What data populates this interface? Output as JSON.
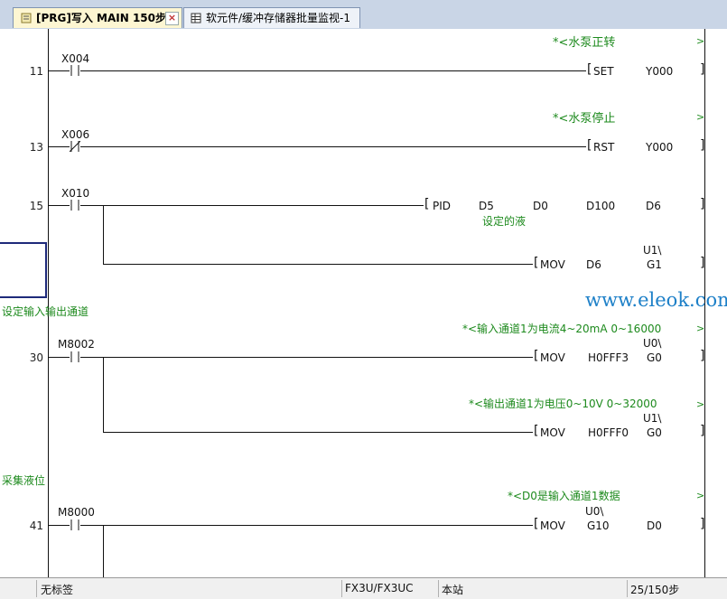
{
  "tabs": [
    {
      "label": "[PRG]写入 MAIN 150步",
      "close": "×"
    },
    {
      "label": "软元件/缓冲存储器批量监视-1"
    }
  ],
  "rungs": [
    {
      "step": "11",
      "contact": "X004",
      "comment": "*<水泵正转",
      "instr": "SET",
      "op1": "Y000"
    },
    {
      "step": "13",
      "contact": "X006",
      "comment": "*<水泵停止",
      "instr": "RST",
      "op1": "Y000"
    },
    {
      "step": "15",
      "contact": "X010",
      "instr": "PID",
      "ops": [
        "D5",
        "D0",
        "D100",
        "D6"
      ],
      "op_comment": "设定的液",
      "branch": {
        "instr": "MOV",
        "op1": "D6",
        "op2_top": "U1\\",
        "op2_bot": "G1"
      }
    },
    {
      "statement": "设定输入输出通道",
      "step": "30",
      "contact": "M8002",
      "comment": "*<输入通道1为电流4~20mA  0~16000",
      "instr": "MOV",
      "op1": "H0FFF3",
      "op2_top": "U0\\",
      "op2_bot": "G0",
      "branch": {
        "comment": "*<输出通道1为电压0~10V 0~32000",
        "instr": "MOV",
        "op1": "H0FFF0",
        "op2_top": "U1\\",
        "op2_bot": "G0"
      }
    },
    {
      "statement": "采集液位",
      "step": "41",
      "contact": "M8000",
      "comment": "*<D0是输入通道1数据",
      "instr": "MOV",
      "op1_top": "U0\\",
      "op1_bot": "G10",
      "op2": "D0"
    }
  ],
  "watermark": "www.eleok.com",
  "status": {
    "label": "无标签",
    "cpu": "FX3U/FX3UC",
    "station": "本站",
    "steps": "25/150步"
  },
  "colors": {
    "comment": "#1d8a1d",
    "tab_active": "#fdf6d2",
    "watermark": "#1e80c8"
  }
}
